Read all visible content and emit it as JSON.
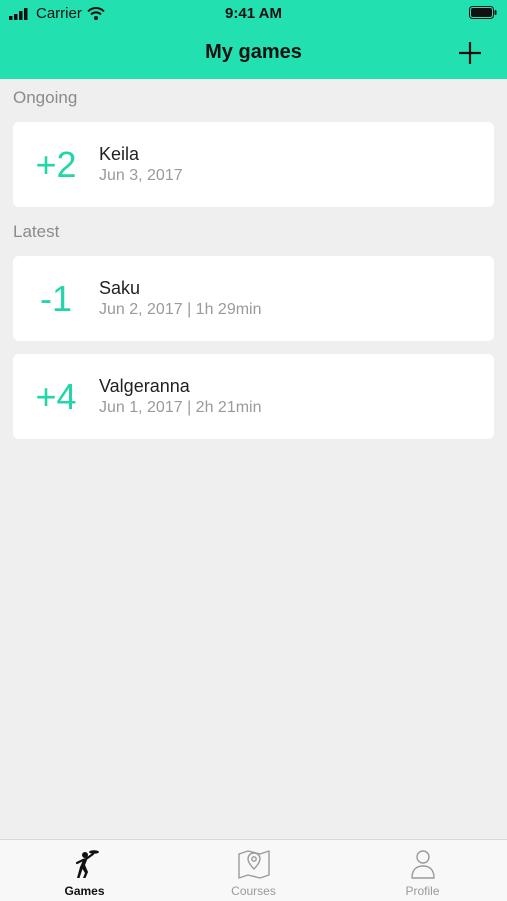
{
  "status_bar": {
    "carrier": "Carrier",
    "time": "9:41 AM"
  },
  "header": {
    "title": "My games"
  },
  "sections": {
    "ongoing": {
      "label": "Ongoing",
      "games": [
        {
          "score": "+2",
          "course": "Keila",
          "meta": "Jun 3, 2017"
        }
      ]
    },
    "latest": {
      "label": "Latest",
      "games": [
        {
          "score": "-1",
          "course": "Saku",
          "meta": "Jun 2, 2017 | 1h 29min"
        },
        {
          "score": "+4",
          "course": "Valgeranna",
          "meta": "Jun 1, 2017 | 2h 21min"
        }
      ]
    }
  },
  "tabs": [
    {
      "label": "Games",
      "icon": "frisbee-player-icon",
      "active": true
    },
    {
      "label": "Courses",
      "icon": "map-pin-icon",
      "active": false
    },
    {
      "label": "Profile",
      "icon": "user-icon",
      "active": false
    }
  ],
  "colors": {
    "accent": "#22e0b0",
    "score": "#22d6a9",
    "background": "#efefef"
  }
}
